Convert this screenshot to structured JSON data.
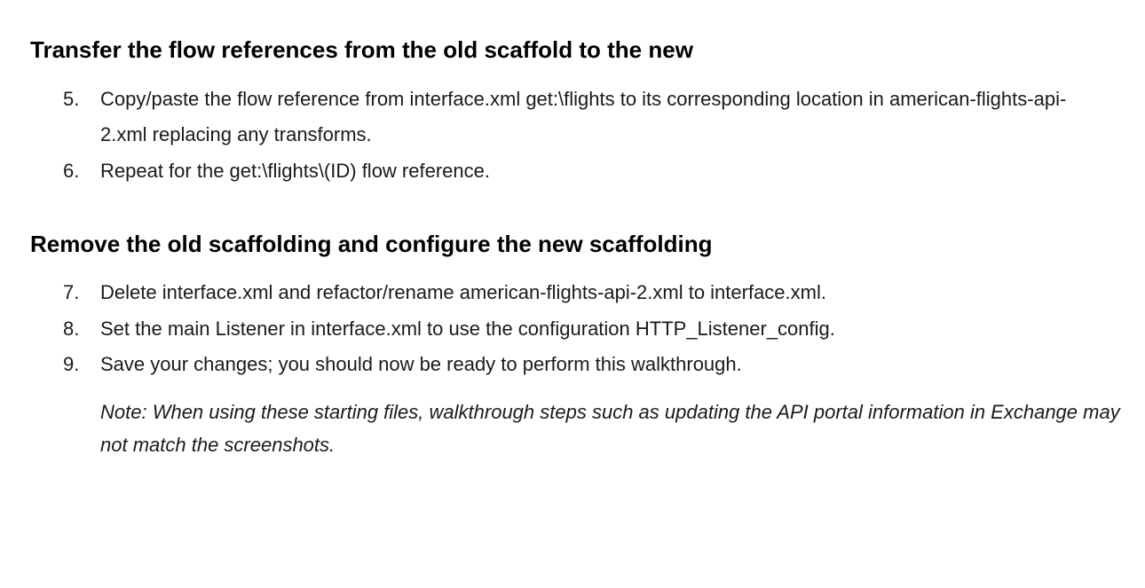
{
  "sections": [
    {
      "heading": "Transfer the flow references from the old scaffold to the new",
      "items": [
        {
          "number": "5.",
          "text": "Copy/paste the flow reference from interface.xml get:\\flights to its corresponding location in american-flights-api-2.xml replacing any transforms."
        },
        {
          "number": "6.",
          "text": "Repeat for the get:\\flights\\(ID) flow reference."
        }
      ]
    },
    {
      "heading": "Remove the old scaffolding and configure the new scaffolding",
      "items": [
        {
          "number": "7.",
          "text": "Delete interface.xml and refactor/rename american-flights-api-2.xml to interface.xml."
        },
        {
          "number": "8.",
          "text": "Set the main Listener in interface.xml to use the configuration HTTP_Listener_config."
        },
        {
          "number": "9.",
          "text": "Save your changes; you should now be ready to perform this walkthrough."
        }
      ],
      "note": "Note: When using these starting files, walkthrough steps such as updating the API portal information in Exchange may not match the screenshots."
    }
  ]
}
